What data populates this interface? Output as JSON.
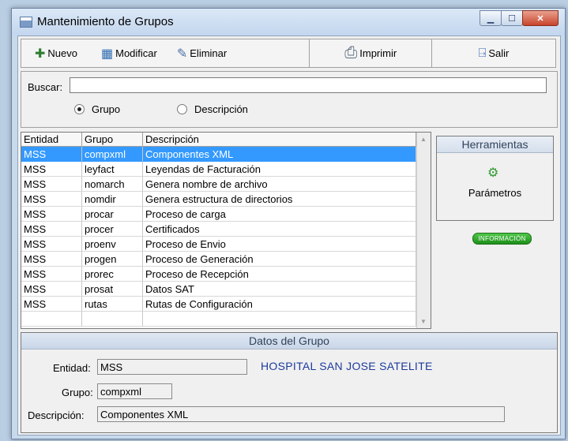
{
  "window": {
    "title": "Mantenimiento de Grupos",
    "caption": {
      "minimize": "▁",
      "maximize": "☐",
      "close": "✕"
    }
  },
  "toolbar": {
    "nuevo": "Nuevo",
    "modificar": "Modificar",
    "eliminar": "Eliminar",
    "imprimir": "Imprimir",
    "salir": "Salir"
  },
  "search": {
    "label": "Buscar:",
    "value": "",
    "options": [
      {
        "label": "Grupo",
        "selected": true
      },
      {
        "label": "Descripción",
        "selected": false
      }
    ]
  },
  "grid": {
    "columns": [
      "Entidad",
      "Grupo",
      "Descripción"
    ],
    "rows": [
      [
        "MSS",
        "compxml",
        "Componentes XML"
      ],
      [
        "MSS",
        "leyfact",
        "Leyendas de Facturación"
      ],
      [
        "MSS",
        "nomarch",
        "Genera nombre de archivo"
      ],
      [
        "MSS",
        "nomdir",
        "Genera estructura de directorios"
      ],
      [
        "MSS",
        "procar",
        "Proceso de carga"
      ],
      [
        "MSS",
        "procer",
        "Certificados"
      ],
      [
        "MSS",
        "proenv",
        "Proceso de Envio"
      ],
      [
        "MSS",
        "progen",
        "Proceso de Generación"
      ],
      [
        "MSS",
        "prorec",
        "Proceso de Recepción"
      ],
      [
        "MSS",
        "prosat",
        "Datos SAT"
      ],
      [
        "MSS",
        "rutas",
        "Rutas de Configuración"
      ]
    ],
    "selected_row": 0
  },
  "tools": {
    "title": "Herramientas",
    "parametros": "Parámetros",
    "info_badge": "INFORMACIÓN"
  },
  "datos": {
    "title": "Datos del Grupo",
    "entidad_label": "Entidad:",
    "entidad_value": "MSS",
    "entidad_name": "HOSPITAL SAN JOSE SATELITE",
    "grupo_label": "Grupo:",
    "grupo_value": "compxml",
    "descripcion_label": "Descripción:",
    "descripcion_value": "Componentes XML"
  },
  "colors": {
    "selection": "#3399ff",
    "hospital_text": "#1d3a9c",
    "badge": "#2a9f25"
  }
}
